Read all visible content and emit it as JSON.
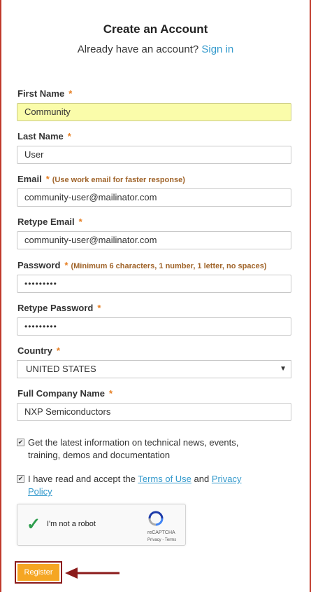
{
  "header": {
    "title": "Create an Account",
    "subtitle_prefix": "Already have an account?",
    "sign_in_link": "Sign in"
  },
  "fields": {
    "first_name": {
      "label": "First Name",
      "required": "*",
      "value": "Community"
    },
    "last_name": {
      "label": "Last Name",
      "required": "*",
      "value": "User"
    },
    "email": {
      "label": "Email",
      "required": "*",
      "hint": "(Use work email for faster response)",
      "value": "community-user@mailinator.com"
    },
    "retype_email": {
      "label": "Retype Email",
      "required": "*",
      "value": "community-user@mailinator.com"
    },
    "password": {
      "label": "Password",
      "required": "*",
      "hint": "(Minimum 6 characters, 1 number, 1 letter, no spaces)",
      "value": "•••••••••"
    },
    "retype_password": {
      "label": "Retype Password",
      "required": "*",
      "value": "•••••••••"
    },
    "country": {
      "label": "Country",
      "required": "*",
      "value": "UNITED STATES"
    },
    "company": {
      "label": "Full Company Name",
      "required": "*",
      "value": "NXP Semiconductors"
    }
  },
  "checkboxes": {
    "newsletter": {
      "checked": true,
      "mark": "✔",
      "text": "Get the latest information on technical news, events, training, demos and documentation"
    },
    "terms": {
      "checked": true,
      "mark": "✔",
      "text_prefix": "I have read and accept the",
      "terms_link": "Terms of Use",
      "and": "and",
      "privacy_link": "Privacy Policy"
    }
  },
  "captcha": {
    "label": "I'm not a robot",
    "brand": "reCAPTCHA",
    "links": "Privacy - Terms"
  },
  "register_button": "Register",
  "colors": {
    "link": "#3399cc",
    "required": "#e67e22",
    "register": "#f5a623",
    "highlight_input": "#fafcaa",
    "annotation": "#8b1a1a"
  }
}
